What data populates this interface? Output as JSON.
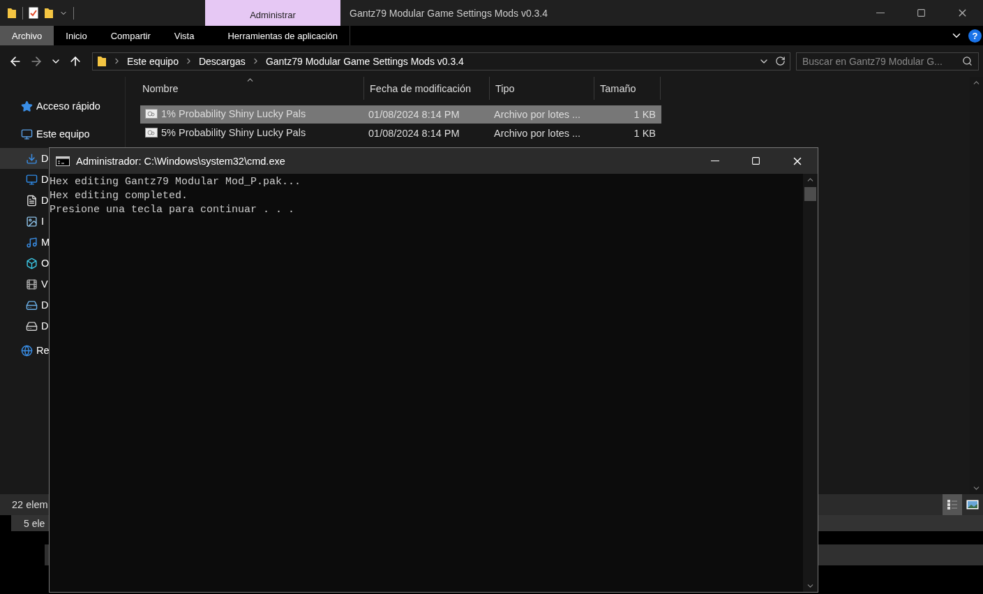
{
  "explorer": {
    "title": "Gantz79 Modular Game Settings Mods v0.3.4",
    "context_tab": "Administrar",
    "ribbon_tabs": [
      {
        "label": "Archivo",
        "selected": true
      },
      {
        "label": "Inicio",
        "selected": false
      },
      {
        "label": "Compartir",
        "selected": false
      },
      {
        "label": "Vista",
        "selected": false
      },
      {
        "label": "Herramientas de aplicación",
        "selected": false
      }
    ],
    "breadcrumb": [
      "Este equipo",
      "Descargas",
      "Gantz79 Modular Game Settings Mods v0.3.4"
    ],
    "search": {
      "placeholder": "Buscar en Gantz79 Modular G..."
    },
    "sidebar": {
      "items": [
        {
          "label": "Acceso rápido",
          "kind": "star",
          "selected": false
        },
        {
          "label": "Este equipo",
          "kind": "pc",
          "selected": false,
          "children": [
            {
              "label": "D",
              "kind": "downloads",
              "selected": true
            },
            {
              "label": "D",
              "kind": "desktop",
              "selected": false
            },
            {
              "label": "D",
              "kind": "documents",
              "selected": false
            },
            {
              "label": "I",
              "kind": "pictures",
              "selected": false
            },
            {
              "label": "M",
              "kind": "music",
              "selected": false
            },
            {
              "label": "O",
              "kind": "objects",
              "selected": false
            },
            {
              "label": "V",
              "kind": "videos",
              "selected": false
            },
            {
              "label": "D",
              "kind": "windisk",
              "selected": false
            },
            {
              "label": "D",
              "kind": "drive",
              "selected": false
            }
          ]
        },
        {
          "label": "Re",
          "kind": "network",
          "selected": false
        }
      ]
    },
    "table": {
      "columns": [
        "Nombre",
        "Fecha de modificación",
        "Tipo",
        "Tamaño"
      ],
      "rows": [
        {
          "name": "1% Probability Shiny Lucky Pals",
          "modified": "01/08/2024 8:14 PM",
          "type": "Archivo por lotes ...",
          "size": "1 KB",
          "selected": true
        },
        {
          "name": "5% Probability Shiny Lucky Pals",
          "modified": "01/08/2024 8:14 PM",
          "type": "Archivo por lotes ...",
          "size": "1 KB",
          "selected": false
        }
      ]
    },
    "status_bar": "22 elem"
  },
  "help": "?",
  "back_window": {
    "status_bar": "5 ele"
  },
  "console": {
    "title": "Administrador: C:\\Windows\\system32\\cmd.exe",
    "lines": [
      "Hex editing Gantz79 Modular Mod_P.pak...",
      "Hex editing completed.",
      "Presione una tecla para continuar . . ."
    ]
  }
}
